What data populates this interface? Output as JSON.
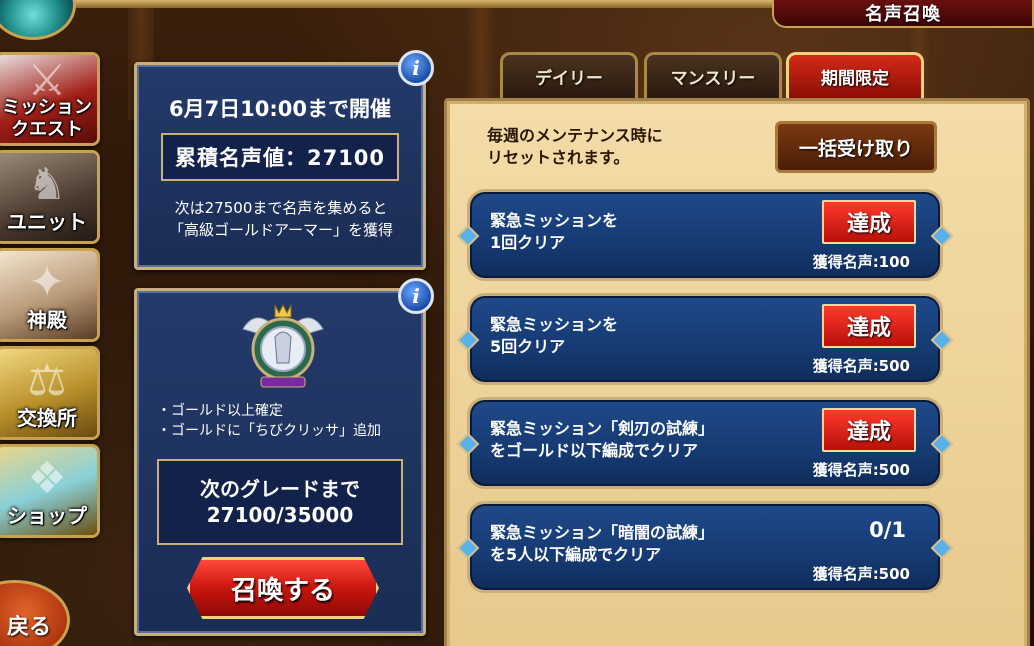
{
  "header": {
    "title": "名声召喚"
  },
  "nav": {
    "items": [
      {
        "label_line1": "ミッション",
        "label_line2": "クエスト"
      },
      {
        "label": "ユニット"
      },
      {
        "label": "神殿"
      },
      {
        "label": "交換所"
      },
      {
        "label": "ショップ"
      }
    ],
    "back_label": "戻る"
  },
  "event_panel": {
    "date_text": "6月7日10:00まで開催",
    "fame_text": "累積名声値：27100",
    "next_reward_line1": "次は27500まで名声を集めると",
    "next_reward_line2": "「高級ゴールドアーマー」を獲得"
  },
  "summon_panel": {
    "bullet1": "・ゴールド以上確定",
    "bullet2": "・ゴールドに「ちびクリッサ」追加",
    "grade_line1": "次のグレードまで",
    "grade_line2": "27100/35000",
    "summon_label": "召喚する"
  },
  "tabs": [
    {
      "label": "デイリー",
      "active": false
    },
    {
      "label": "マンスリー",
      "active": false
    },
    {
      "label": "期間限定",
      "active": true
    }
  ],
  "mission_panel": {
    "notice_line1": "毎週のメンテナンス時に",
    "notice_line2": "リセットされます。",
    "claim_all_label": "一括受け取り",
    "missions": [
      {
        "line1": "緊急ミッションを",
        "line2": "1回クリア",
        "action": "達成",
        "reward": "獲得名声:100"
      },
      {
        "line1": "緊急ミッションを",
        "line2": "5回クリア",
        "action": "達成",
        "reward": "獲得名声:500"
      },
      {
        "line1": "緊急ミッション「剣刃の試練」",
        "line2": "をゴールド以下編成でクリア",
        "action": "達成",
        "reward": "獲得名声:500"
      },
      {
        "line1": "緊急ミッション「暗闇の試練」",
        "line2": "を5人以下編成でクリア",
        "progress": "0/1",
        "reward": "獲得名声:500"
      }
    ]
  }
}
